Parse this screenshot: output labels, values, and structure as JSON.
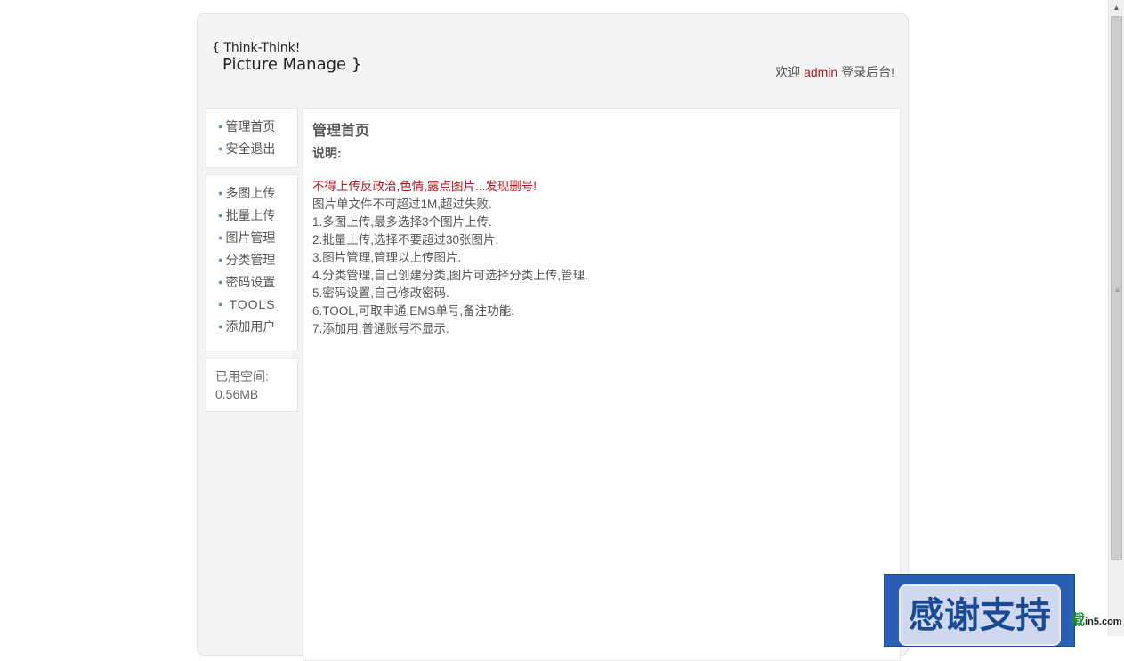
{
  "header": {
    "logo_line1": "{ Think-Think!",
    "logo_line2": "Picture Manage }",
    "welcome_prefix": "欢迎",
    "username": "admin",
    "welcome_suffix": "登录后台!"
  },
  "sidebar": {
    "group1": [
      {
        "label": "管理首页"
      },
      {
        "label": "安全退出"
      }
    ],
    "group2": [
      {
        "label": "多图上传"
      },
      {
        "label": "批量上传"
      },
      {
        "label": "图片管理"
      },
      {
        "label": "分类管理"
      },
      {
        "label": "密码设置"
      },
      {
        "label": "TOOLS"
      },
      {
        "label": "添加用户"
      }
    ],
    "space_label": "已用空间:",
    "space_value": "0.56MB"
  },
  "main": {
    "title": "管理首页",
    "intro_label": "说明:",
    "warning": "不得上传反政治,色情,露点图片...发现删号!",
    "notes": [
      "图片单文件不可超过1M,超过失败.",
      "1.多图上传,最多选择3个图片上传.",
      "2.批量上传,选择不要超过30张图片.",
      "3.图片管理,管理以上传图片.",
      "4.分类管理,自己创建分类,图片可选择分类上传,管理.",
      "5.密码设置,自己修改密码.",
      "6.TOOL,可取申通,EMS单号,备注功能.",
      "7.添加用,普通账号不显示."
    ]
  },
  "overlay": {
    "banner_text": "感谢支持",
    "corner_text": "in5.com"
  },
  "colors": {
    "accent_red": "#b0161e",
    "bullet_blue": "#5b8ec0",
    "banner_blue": "#2a5fb5"
  }
}
